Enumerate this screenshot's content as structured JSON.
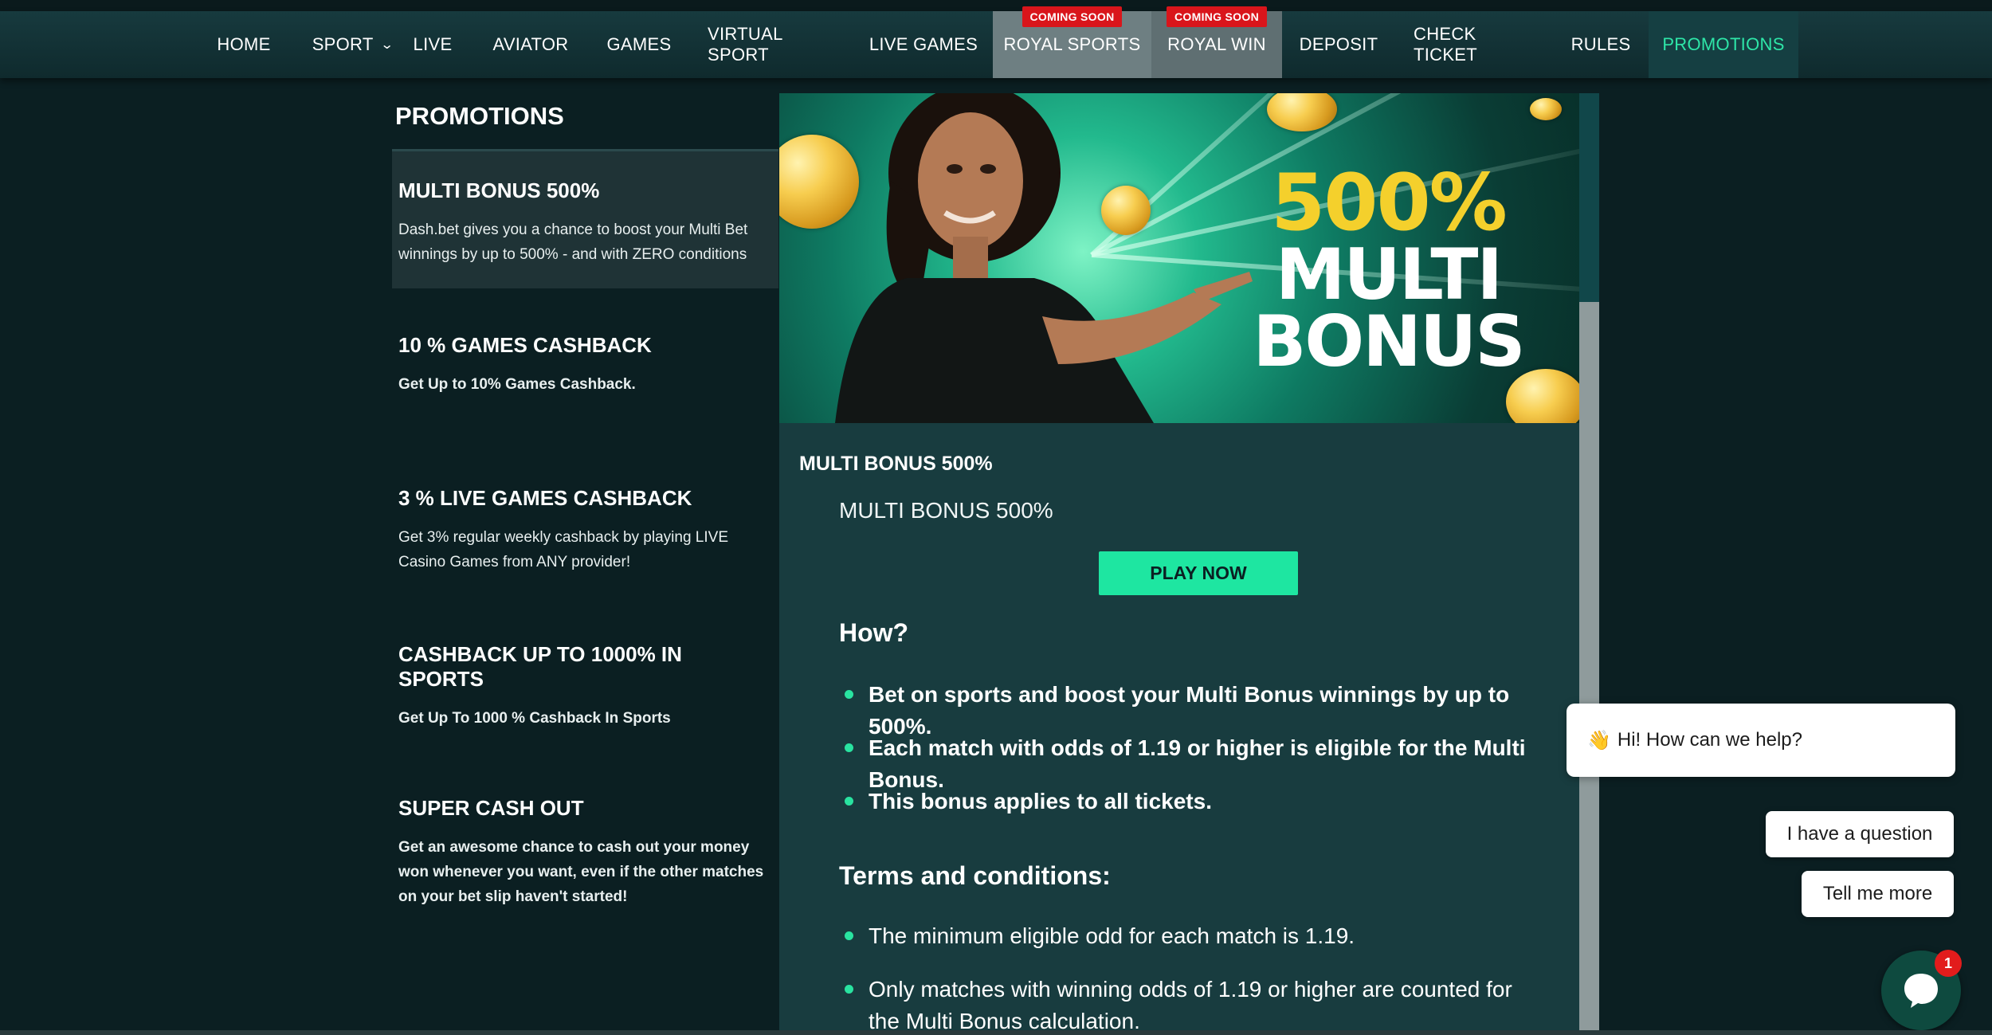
{
  "nav": {
    "items": [
      {
        "label": "HOME"
      },
      {
        "label": "SPORT"
      },
      {
        "label": "LIVE"
      },
      {
        "label": "AVIATOR"
      },
      {
        "label": "GAMES"
      },
      {
        "label": "VIRTUAL SPORT"
      },
      {
        "label": "LIVE GAMES"
      },
      {
        "label": "ROYAL SPORTS",
        "badge": "COMING SOON"
      },
      {
        "label": "ROYAL WIN",
        "badge": "COMING SOON"
      },
      {
        "label": "DEPOSIT"
      },
      {
        "label": "CHECK TICKET"
      },
      {
        "label": "RULES"
      },
      {
        "label": "PROMOTIONS"
      }
    ],
    "sport_chevron_icon": "chevron-down-icon",
    "active_color": "#2ee6a8",
    "badge_color": "#d9151b"
  },
  "sidebar": {
    "title": "PROMOTIONS",
    "items": [
      {
        "title": "MULTI BONUS 500%",
        "desc": "Dash.bet gives you a chance to boost your Multi Bet winnings by up to 500% - and with ZERO conditions"
      },
      {
        "title": "10 % GAMES CASHBACK",
        "desc": "Get Up to 10% Games Cashback."
      },
      {
        "title": "3 % LIVE GAMES CASHBACK",
        "desc": "Get 3% regular weekly cashback by playing LIVE Casino Games from ANY provider!"
      },
      {
        "title": "CASHBACK UP TO 1000% IN SPORTS",
        "desc": "Get Up To 1000 % Cashback In Sports"
      },
      {
        "title": "SUPER CASH OUT",
        "desc": "Get an awesome chance to cash out your money won whenever you want, even if the other matches on your bet slip haven't started!"
      }
    ]
  },
  "banner": {
    "line1": "500%",
    "line2": "MULTI",
    "line3": "BONUS",
    "accent_color": "#f4d02c"
  },
  "content": {
    "title": "MULTI BONUS 500%",
    "subtitle": "MULTI BONUS 500%",
    "play_label": "PLAY NOW",
    "how_heading": "How?",
    "how_items": [
      "Bet on sports and boost your Multi Bonus winnings by up to 500%.",
      "Each match with odds of 1.19 or higher is eligible for the Multi Bonus.",
      "This bonus applies to all tickets."
    ],
    "terms_heading": "Terms and conditions:",
    "terms_items": [
      "The minimum eligible odd for each match is 1.19.",
      "Only matches with winning odds of 1.19 or higher are counted for the Multi Bonus calculation."
    ],
    "button_color": "#1ee6a1"
  },
  "chat": {
    "greeting_icon": "waving-hand-icon",
    "greeting": "Hi! How can we help?",
    "options": [
      "I have a question",
      "Tell me more"
    ],
    "unread_count": "1"
  }
}
